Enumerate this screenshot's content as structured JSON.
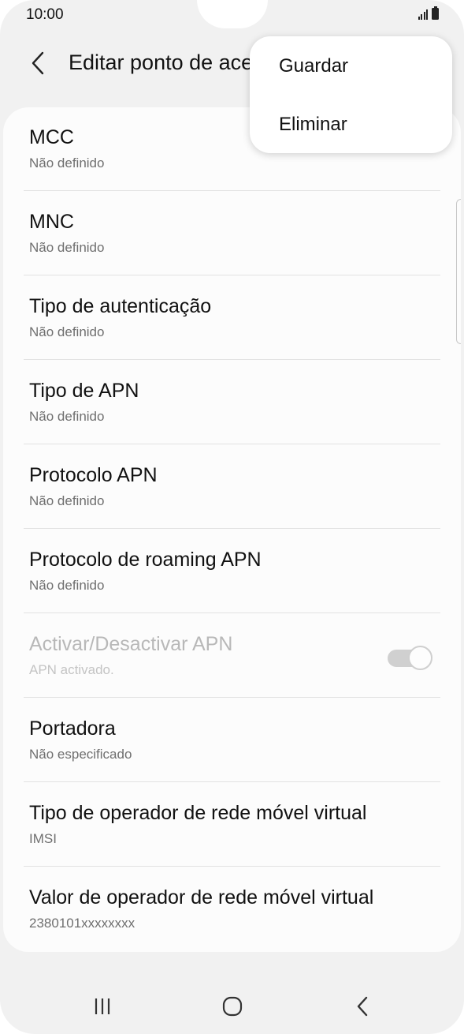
{
  "status_bar": {
    "time": "10:00"
  },
  "header": {
    "title": "Editar ponto de acesso",
    "back_icon": "chevron-left-icon"
  },
  "menu": {
    "items": [
      {
        "label": "Guardar"
      },
      {
        "label": "Eliminar"
      }
    ]
  },
  "settings": {
    "items": [
      {
        "title": "MCC",
        "subtitle": "Não definido"
      },
      {
        "title": "MNC",
        "subtitle": "Não definido"
      },
      {
        "title": "Tipo de autenticação",
        "subtitle": "Não definido"
      },
      {
        "title": "Tipo de APN",
        "subtitle": "Não definido"
      },
      {
        "title": "Protocolo APN",
        "subtitle": "Não definido"
      },
      {
        "title": "Protocolo de roaming APN",
        "subtitle": "Não definido"
      },
      {
        "title": "Activar/Desactivar APN",
        "subtitle": "APN activado.",
        "toggle_on": true,
        "disabled": true
      },
      {
        "title": "Portadora",
        "subtitle": "Não especificado"
      },
      {
        "title": "Tipo de operador de rede móvel virtual",
        "subtitle": "IMSI"
      },
      {
        "title": "Valor de operador de rede móvel virtual",
        "subtitle": "2380101xxxxxxxx"
      }
    ]
  },
  "nav_bar": {
    "recents_icon": "recents-icon",
    "home_icon": "home-icon",
    "back_icon": "back-icon"
  },
  "colors": {
    "background": "#f1f1f1",
    "card": "#fcfcfc",
    "toggle_track": "#d0d0d0"
  }
}
